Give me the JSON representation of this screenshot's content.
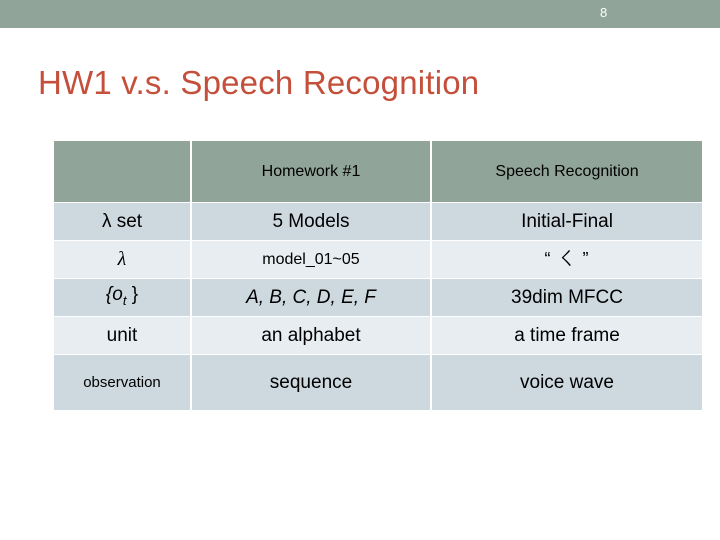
{
  "banner": {
    "page_number": "8",
    "color": "#91a499"
  },
  "title": {
    "text": "HW1 v.s. Speech Recognition",
    "color": "#c4503b"
  },
  "table": {
    "headers": {
      "corner": "",
      "homework": "Homework  #1",
      "speech": "Speech Recognition"
    },
    "rows": [
      {
        "label": "λ set",
        "homework": "5 Models",
        "speech": "Initial-Final"
      },
      {
        "label": "λ",
        "homework": "model_01~05",
        "speech": "“ ㄑ ”"
      },
      {
        "label": "{o_t }",
        "label_base": "{o",
        "label_sub": "t",
        "label_tail": " }",
        "homework": "A, B, C, D, E, F",
        "speech": "39dim MFCC"
      },
      {
        "label": "unit",
        "homework": "an alphabet",
        "speech": "a time frame"
      },
      {
        "label": "observation",
        "homework": "sequence",
        "speech": "voice wave"
      }
    ]
  },
  "colors": {
    "row_dark": "#cdd9df",
    "row_light": "#e7edf0",
    "header_bg": "#91a499",
    "header_text": "#ffffff",
    "body_text": "#000000"
  }
}
